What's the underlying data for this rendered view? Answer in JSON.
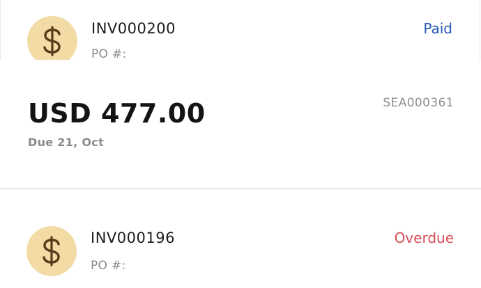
{
  "invoices": [
    {
      "number": "INV000200",
      "po_label": "PO #:",
      "status": "Paid",
      "status_color": "#2456b3",
      "amount": "USD 477.00",
      "due": "Due 21, Oct",
      "reference": "SEA000361",
      "icon": "dollar-icon"
    },
    {
      "number": "INV000196",
      "po_label": "PO #:",
      "status": "Overdue",
      "status_color": "#d74a55",
      "icon": "dollar-icon"
    }
  ],
  "colors": {
    "avatar_bg": "#f3dba6",
    "dollar_icon": "#5a3b1a"
  }
}
